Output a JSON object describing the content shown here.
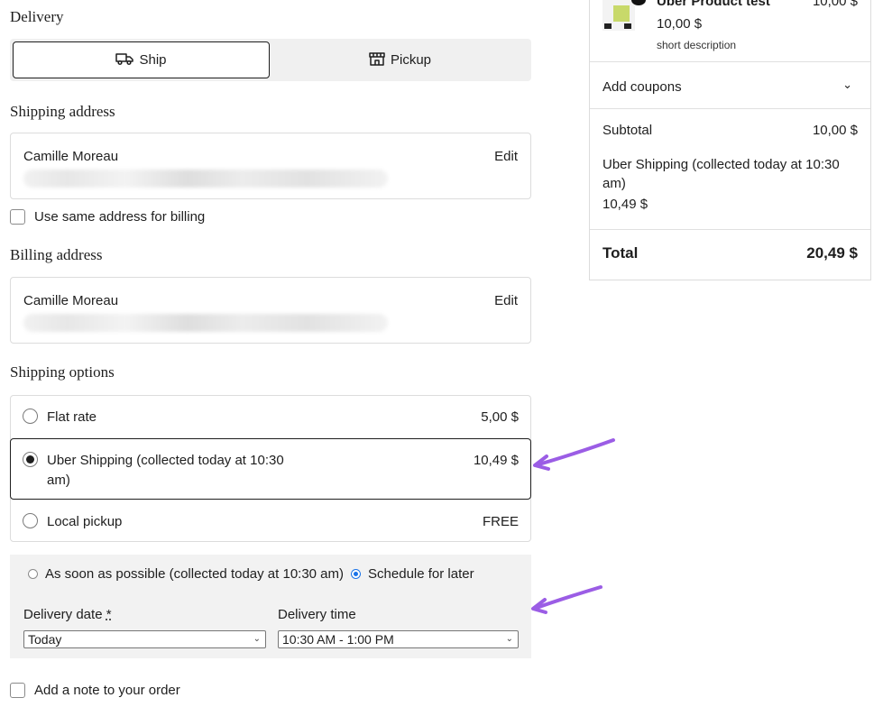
{
  "delivery": {
    "heading": "Delivery",
    "ship_label": "Ship",
    "pickup_label": "Pickup"
  },
  "shipping_address": {
    "heading": "Shipping address",
    "name": "Camille Moreau",
    "edit_label": "Edit"
  },
  "same_billing": {
    "label": "Use same address for billing"
  },
  "billing_address": {
    "heading": "Billing address",
    "name": "Camille Moreau",
    "edit_label": "Edit"
  },
  "shipping_options": {
    "heading": "Shipping options",
    "items": [
      {
        "label": "Flat rate",
        "price": "5,00 $",
        "selected": false
      },
      {
        "label": "Uber Shipping (collected today at 10:30",
        "label2": "am)",
        "price": "10,49 $",
        "selected": true
      },
      {
        "label": "Local pickup",
        "price": "FREE",
        "selected": false
      }
    ]
  },
  "schedule": {
    "asap_label": "As soon as possible (collected today at 10:30 am)",
    "later_label": "Schedule for later",
    "date_label": "Delivery date",
    "required_mark": "*",
    "time_label": "Delivery time",
    "date_value": "Today",
    "time_value": "10:30 AM - 1:00 PM"
  },
  "note": {
    "label": "Add a note to your order"
  },
  "summary": {
    "product_name": "Uber Product test",
    "product_total": "10,00 $",
    "product_price": "10,00 $",
    "product_desc": "short description",
    "coupons_label": "Add coupons",
    "subtotal_label": "Subtotal",
    "subtotal_value": "10,00 $",
    "shipping_line1": "Uber Shipping (collected today at 10:30",
    "shipping_line2": "am)",
    "shipping_value": "10,49 $",
    "total_label": "Total",
    "total_value": "20,49 $"
  },
  "colors": {
    "arrow": "#9b5de5",
    "radio_accent": "#1a73e8"
  }
}
